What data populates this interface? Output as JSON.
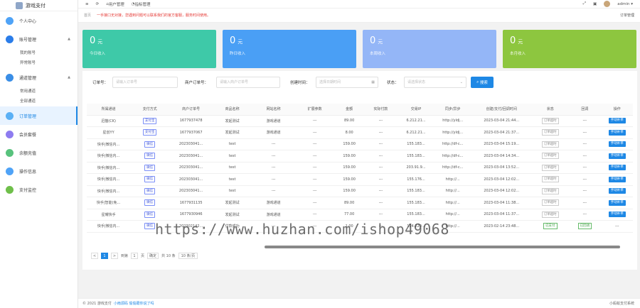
{
  "app": {
    "name": "游戏支付"
  },
  "sidebar": {
    "items": [
      {
        "label": "个人中心",
        "color": "#4fa3f7"
      },
      {
        "label": "账号管理",
        "color": "#2b7de9",
        "caret": "▲",
        "subs": [
          "我的账号",
          "异常账号"
        ]
      },
      {
        "label": "通道管理",
        "color": "#3a8ee6",
        "caret": "▲",
        "subs": [
          "常用通道",
          "全部通道"
        ]
      },
      {
        "label": "订单管理",
        "color": "#5ab0f5"
      },
      {
        "label": "会员套餐",
        "color": "#8e7cf0"
      },
      {
        "label": "余额充值",
        "color": "#58c27d"
      },
      {
        "label": "操作信息",
        "color": "#4fa3f7"
      },
      {
        "label": "支付监控",
        "color": "#6fbf4a"
      }
    ]
  },
  "topbar": {
    "menu_icon": "≡",
    "refresh_icon": "⟳",
    "tab1": "用户管理",
    "tab2": "指标管理",
    "user": "admin ▾"
  },
  "breadcrumb": {
    "home": "首页",
    "notice": "一手接口无对接，您遇到问题可以联系我们的官方客服，服务时间使用。",
    "current": "订单管理"
  },
  "cards": [
    {
      "value": "0",
      "unit": "元",
      "label": "今日收入",
      "color": "#3ec9a8"
    },
    {
      "value": "0",
      "unit": "元",
      "label": "昨日收入",
      "color": "#4a9ff5"
    },
    {
      "value": "0",
      "unit": "元",
      "label": "本周收入",
      "color": "#94b6f7"
    },
    {
      "value": "0",
      "unit": "元",
      "label": "本月收入",
      "color": "#8dc63f"
    }
  ],
  "filters": {
    "order_label": "订单号：",
    "order_ph": "请输入订单号",
    "user_order_label": "商户订单号：",
    "user_order_ph": "请输入商户订单号",
    "time_label": "创建时间：",
    "time_ph": "选择日期时间",
    "status_label": "状态：",
    "status_ph": "请选择状态",
    "search_btn": "搜索"
  },
  "table": {
    "headers": [
      "所属通道",
      "支付方式",
      "商户订单号",
      "商品名称",
      "网站名称",
      "扩展参数",
      "金额",
      "实际付款",
      "交易IP",
      "同步/异步",
      "创建/支付/回调时间",
      "状态",
      "回调",
      "操作"
    ],
    "rows": [
      [
        "迅猫(CK)",
        "支付宝",
        "1677937478",
        "发起测试",
        "游戏通道",
        "---",
        "89.00",
        "---",
        "6.212.21...",
        "http://yldj...",
        "2023-03-04 21:44...",
        "订单超时",
        "---",
        "手动补单"
      ],
      [
        "星创YY",
        "支付宝",
        "1677937067",
        "发起测试",
        "游戏通道",
        "---",
        "8.00",
        "---",
        "6.212.21...",
        "http://yldj...",
        "2023-03-04 21:37...",
        "订单超时",
        "---",
        "手动补单"
      ],
      [
        "快手|微信内...",
        "微信",
        "202303041...",
        "test",
        "---",
        "---",
        "159.00",
        "---",
        "155.183...",
        "http://df-c...",
        "2023-03-04 15:19...",
        "订单超时",
        "---",
        "手动补单"
      ],
      [
        "快手|微信内...",
        "微信",
        "202303041...",
        "test",
        "---",
        "---",
        "159.00",
        "---",
        "155.183...",
        "http://df-c...",
        "2023-03-04 14:34...",
        "订单超时",
        "---",
        "手动补单"
      ],
      [
        "快手|微信内...",
        "微信",
        "202303041...",
        "test",
        "---",
        "---",
        "159.00",
        "---",
        "203.91.9...",
        "http://df-c...",
        "2023-03-04 13:52...",
        "订单超时",
        "---",
        "手动补单"
      ],
      [
        "快手|微信内...",
        "微信",
        "202303041...",
        "test",
        "---",
        "---",
        "159.00",
        "---",
        "155.176...",
        "http://...",
        "2023-03-04 12:02...",
        "订单超时",
        "---",
        "手动补单"
      ],
      [
        "快手|微信内...",
        "微信",
        "202303041...",
        "test",
        "---",
        "---",
        "159.00",
        "---",
        "155.183...",
        "http://...",
        "2023-03-04 12:02...",
        "订单超时",
        "---",
        "手动补单"
      ],
      [
        "快手|智能(免...",
        "微信",
        "1677931135",
        "发起测试",
        "游戏通道",
        "---",
        "89.00",
        "---",
        "155.183...",
        "http://...",
        "2023-03-04 11:38...",
        "订单超时",
        "---",
        "手动补单"
      ],
      [
        "星耀快手",
        "微信",
        "1677930946",
        "发起测试",
        "游戏通道",
        "---",
        "77.00",
        "---",
        "155.183...",
        "http://...",
        "2023-03-04 11:37...",
        "订单超时",
        "---",
        "手动补单"
      ],
      [
        "快手|微信内...",
        "微信",
        "202302142...",
        "付款成功",
        "---",
        "---",
        "1.00",
        "---",
        "124.220...",
        "http://...",
        "2023-02-14 23:48...",
        "已支付",
        "已回调",
        "---"
      ]
    ]
  },
  "pager": {
    "prev": "<",
    "page": "1",
    "next": ">",
    "goto": "到第",
    "goto_val": "1",
    "page_unit": "页",
    "confirm": "确定",
    "total": "共 10 条",
    "per_page": "10 条/页"
  },
  "footer": {
    "copyright": "© 2021 游戏支付",
    "link": "小雨源码 偷偷跟你说了吗",
    "right": "小蚂蚁支付系统"
  },
  "watermark": "https://www.huzhan.com/ishop49068"
}
